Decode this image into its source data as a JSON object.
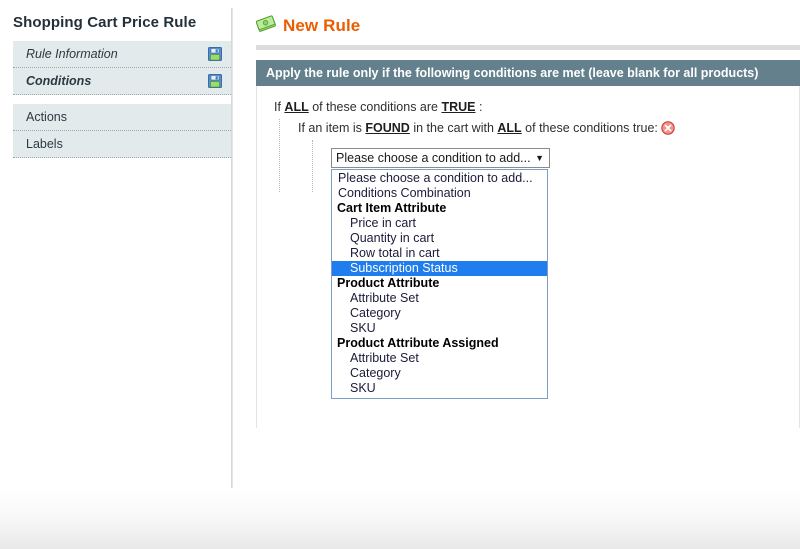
{
  "sidebar": {
    "title": "Shopping Cart Price Rule",
    "items": [
      {
        "label": "Rule Information",
        "style": "italic",
        "icon": "save-icon",
        "active": false
      },
      {
        "label": "Conditions",
        "style": "italic-bold",
        "icon": "save-icon",
        "active": true
      },
      {
        "label": "Actions",
        "style": "normal",
        "icon": null,
        "active": false
      },
      {
        "label": "Labels",
        "style": "normal",
        "icon": null,
        "active": false
      }
    ]
  },
  "header": {
    "title": "New Rule",
    "icon": "money-icon",
    "title_color": "#eb5e00"
  },
  "conditions": {
    "panel_header": "Apply the rule only if the following conditions are met (leave blank for all products)",
    "panel_header_bg": "#63808c",
    "line1": {
      "prefix": "If ",
      "link1": "ALL",
      "middle": " of these conditions are ",
      "link2": "TRUE",
      "suffix": " :"
    },
    "line2": {
      "prefix": "If an item is ",
      "link1": "FOUND",
      "middle": " in the cart with ",
      "link2": "ALL",
      "suffix": " of these conditions true:",
      "delete_icon": "delete-circle-icon"
    },
    "add_icon": "add-circle-icon",
    "select": {
      "value": "Please choose a condition to add...",
      "arrow": "▼",
      "selected_option": "Subscription Status",
      "highlight_color": "#1f7ded",
      "options": [
        {
          "label": "Please choose a condition to add...",
          "type": "item"
        },
        {
          "label": "Conditions Combination",
          "type": "item"
        },
        {
          "label": "Cart Item Attribute",
          "type": "group"
        },
        {
          "label": "Price in cart",
          "type": "child"
        },
        {
          "label": "Quantity in cart",
          "type": "child"
        },
        {
          "label": "Row total in cart",
          "type": "child"
        },
        {
          "label": "Subscription Status",
          "type": "child",
          "selected": true
        },
        {
          "label": "Product Attribute",
          "type": "group"
        },
        {
          "label": "Attribute Set",
          "type": "child"
        },
        {
          "label": "Category",
          "type": "child"
        },
        {
          "label": "SKU",
          "type": "child"
        },
        {
          "label": "Product Attribute Assigned",
          "type": "group"
        },
        {
          "label": "Attribute Set",
          "type": "child"
        },
        {
          "label": "Category",
          "type": "child"
        },
        {
          "label": "SKU",
          "type": "child"
        }
      ]
    }
  }
}
